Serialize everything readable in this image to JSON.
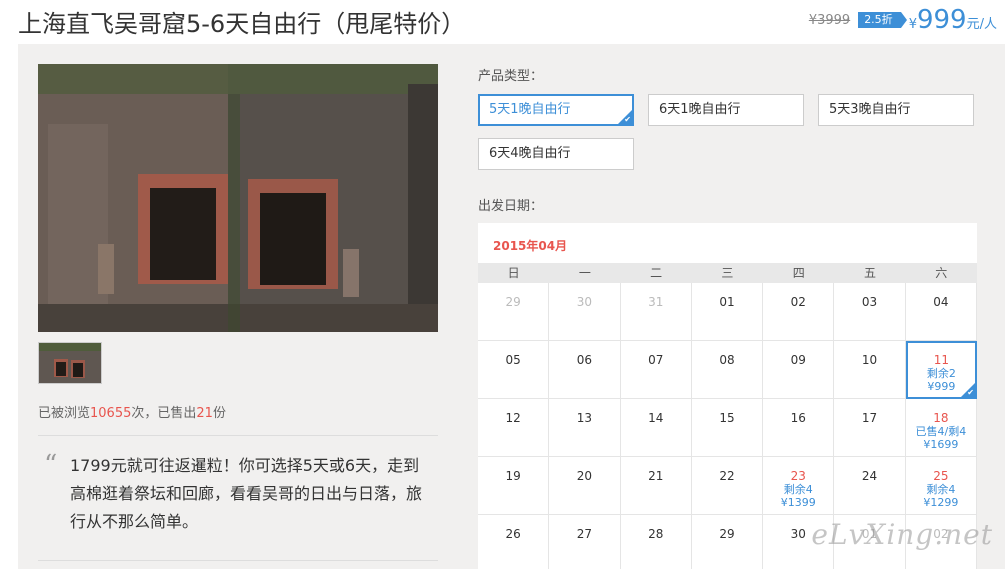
{
  "title": "上海直飞吴哥窟5-6天自由行（甩尾特价）",
  "price": {
    "old": "¥3999",
    "discount": "2.5折",
    "currency": "¥",
    "value": "999",
    "unit": "元/人"
  },
  "stats": {
    "prefix": "已被浏览",
    "views": "10655",
    "mid": "次，已售出",
    "sold": "21",
    "suffix": "份"
  },
  "quote": {
    "mark": "“",
    "text": "1799元就可往返暹粒！你可选择5天或6天，走到高棉逛着祭坛和回廊，看看吴哥的日出与日落，旅行从不那么简单。"
  },
  "product_type": {
    "label": "产品类型：",
    "options": [
      "5天1晚自由行",
      "6天1晚自由行",
      "5天3晚自由行",
      "6天4晚自由行"
    ],
    "selected_index": 0
  },
  "departure": {
    "label": "出发日期："
  },
  "calendar": {
    "month": "2015年04月",
    "weekdays": [
      "日",
      "一",
      "二",
      "三",
      "四",
      "五",
      "六"
    ],
    "rows": [
      [
        {
          "d": "29",
          "other": true
        },
        {
          "d": "30",
          "other": true
        },
        {
          "d": "31",
          "other": true
        },
        {
          "d": "01"
        },
        {
          "d": "02"
        },
        {
          "d": "03"
        },
        {
          "d": "04"
        }
      ],
      [
        {
          "d": "05"
        },
        {
          "d": "06"
        },
        {
          "d": "07"
        },
        {
          "d": "08"
        },
        {
          "d": "09"
        },
        {
          "d": "10"
        },
        {
          "d": "11",
          "avail": true,
          "sel": true,
          "stock": "剩余2",
          "price": "¥999"
        }
      ],
      [
        {
          "d": "12"
        },
        {
          "d": "13"
        },
        {
          "d": "14"
        },
        {
          "d": "15"
        },
        {
          "d": "16"
        },
        {
          "d": "17"
        },
        {
          "d": "18",
          "avail": true,
          "stock": "已售4/剩4",
          "price": "¥1699"
        }
      ],
      [
        {
          "d": "19"
        },
        {
          "d": "20"
        },
        {
          "d": "21"
        },
        {
          "d": "22"
        },
        {
          "d": "23",
          "avail": true,
          "stock": "剩余4",
          "price": "¥1399"
        },
        {
          "d": "24"
        },
        {
          "d": "25",
          "avail": true,
          "stock": "剩余4",
          "price": "¥1299"
        }
      ],
      [
        {
          "d": "26"
        },
        {
          "d": "27"
        },
        {
          "d": "28"
        },
        {
          "d": "29"
        },
        {
          "d": "30"
        },
        {
          "d": "01",
          "other": true
        },
        {
          "d": "02",
          "other": true
        }
      ]
    ]
  },
  "watermark": "eLvXing.net",
  "colors": {
    "accent": "#3d8fd7",
    "highlight": "#e8554e",
    "panel_bg": "#f1f0ef"
  }
}
